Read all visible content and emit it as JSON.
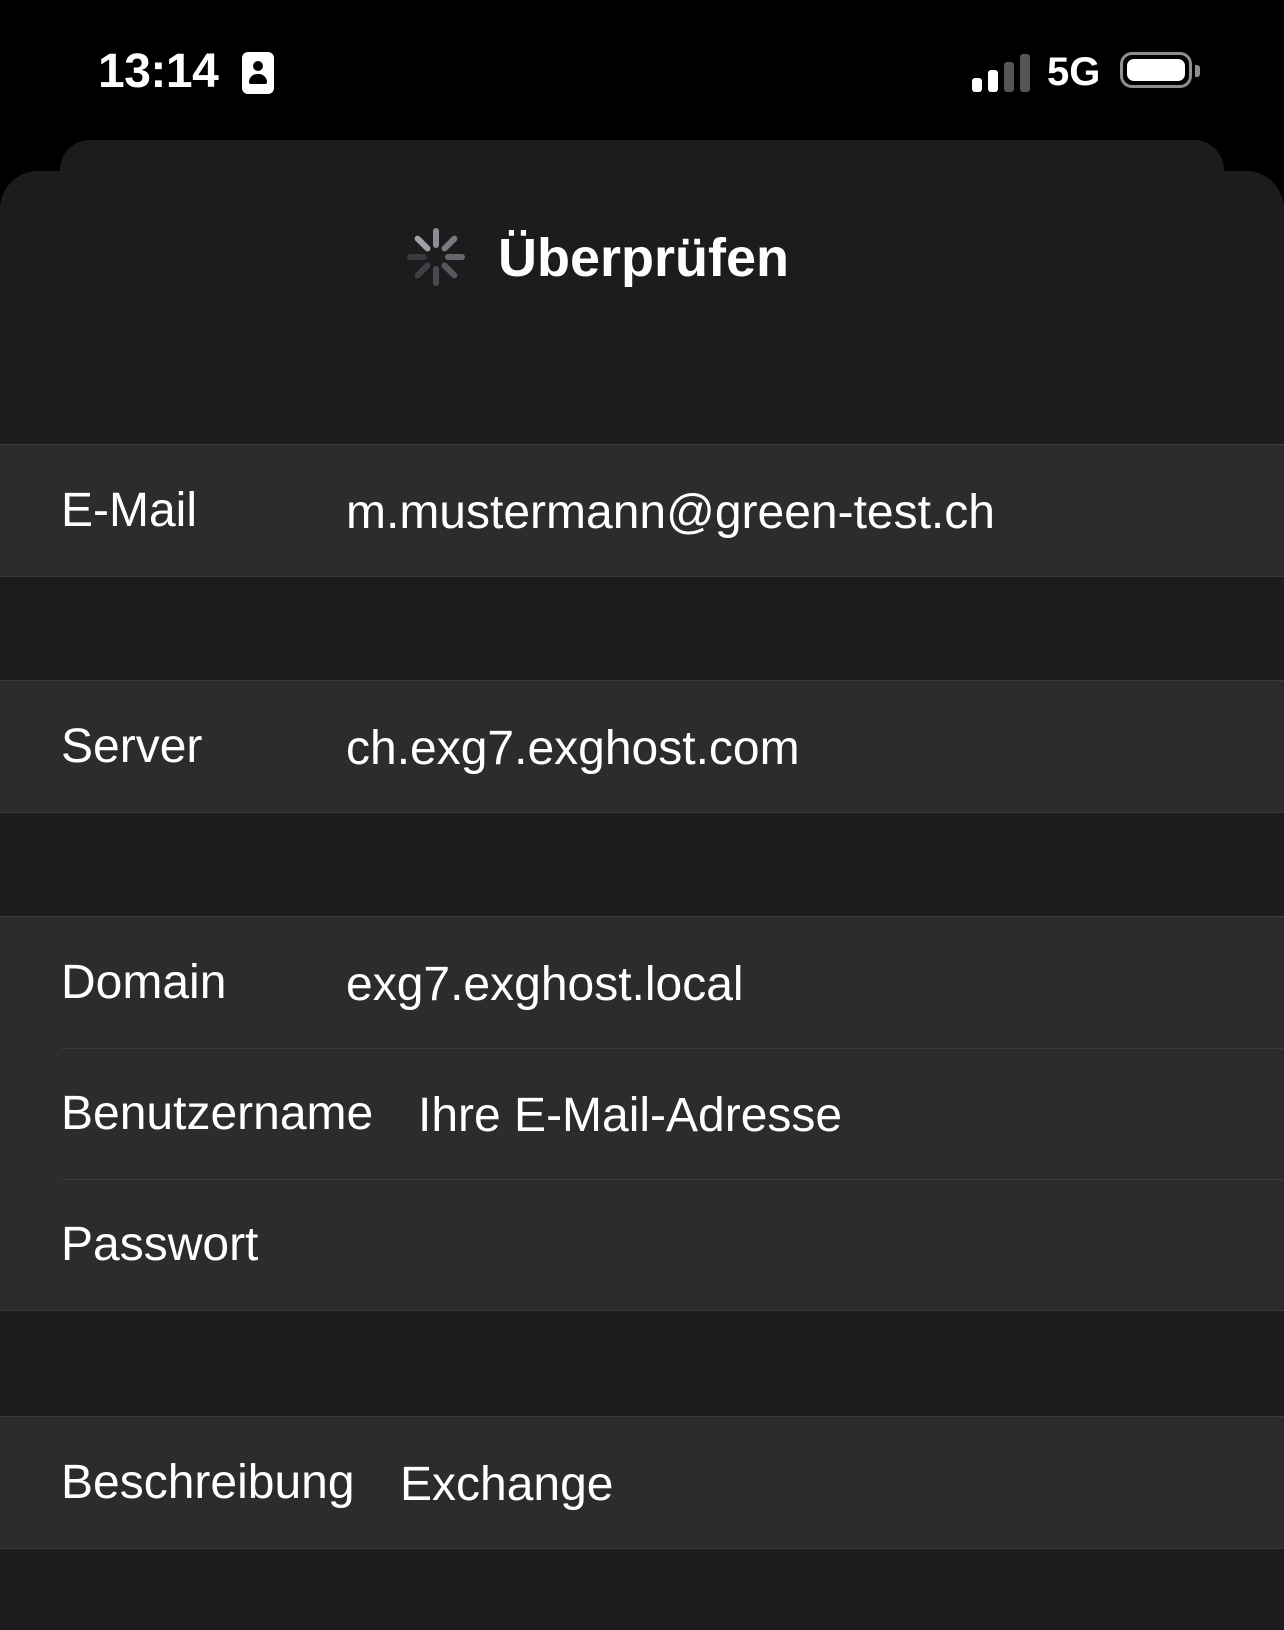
{
  "status_bar": {
    "time": "13:14",
    "network": "5G",
    "icons": [
      "contact-card-icon",
      "cellular-signal-icon",
      "battery-icon"
    ]
  },
  "nav": {
    "title": "Überprüfen",
    "activity_indicator": "spinner-icon"
  },
  "account": {
    "email_label": "E-Mail",
    "email_value": "m.mustermann@green-test.ch",
    "server_label": "Server",
    "server_value": "ch.exg7.exghost.com",
    "domain_label": "Domain",
    "domain_value": "exg7.exghost.local",
    "username_label": "Benutzername",
    "username_value": "Ihre E-Mail-Adresse",
    "password_label": "Passwort",
    "password_value": "",
    "description_label": "Beschreibung",
    "description_value": "Exchange"
  },
  "colors": {
    "background": "#000000",
    "sheet": "#1c1c1e",
    "cell": "#2c2c2e",
    "separator": "#3a3a3c",
    "text": "#ffffff"
  }
}
